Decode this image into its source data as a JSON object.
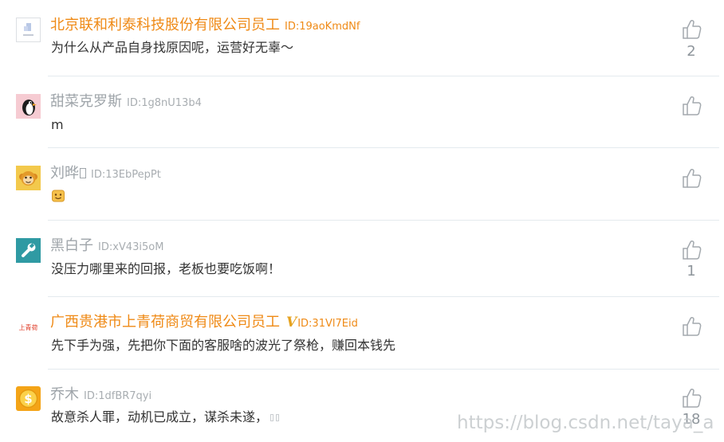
{
  "comments": [
    {
      "name": "北京联和利泰科技股份有限公司员工",
      "uid": "ID:19aoKmdNf",
      "verified": false,
      "name_color": "orange",
      "avatar": "company-logo-placeholder",
      "content": "为什么从产品自身找原因呢，运营好无辜～",
      "likes": "2"
    },
    {
      "name": "甜菜克罗斯",
      "uid": "ID:1g8nU13b4",
      "verified": false,
      "name_color": "gray",
      "avatar": "penguin-avatar",
      "content": "m",
      "likes": ""
    },
    {
      "name": "刘晔",
      "uid": "ID:13EbPepPt",
      "verified": false,
      "name_color": "gray",
      "avatar": "monkey-avatar",
      "content": "",
      "emoji": "smiley-emoji",
      "likes": ""
    },
    {
      "name": "黑白子",
      "uid": "ID:xV43i5oM",
      "verified": false,
      "name_color": "gray",
      "avatar": "wrench-avatar",
      "content": "没压力哪里来的回报，老板也要吃饭啊！",
      "likes": "1"
    },
    {
      "name": "广西贵港市上青荷商贸有限公司员工",
      "uid": "ID:31Vl7Eid",
      "verified": true,
      "verified_mark": "V",
      "name_color": "orange",
      "avatar": "company-logo",
      "avatar_text": "上青荷",
      "content": "先下手为强，先把你下面的客服啥的波光了祭枪，赚回本钱先",
      "likes": ""
    },
    {
      "name": "乔木",
      "uid": "ID:1dfBR7qyi",
      "verified": false,
      "name_color": "gray",
      "avatar": "coin-avatar",
      "content": "故意杀人罪，动机已成立，谋杀未遂，",
      "likes": "18"
    }
  ],
  "colors": {
    "orange": "#ef8a16",
    "gray": "#9fa5aa",
    "divider": "#e4eaee"
  },
  "watermark": "https://blog.csdn.net/taya_a"
}
